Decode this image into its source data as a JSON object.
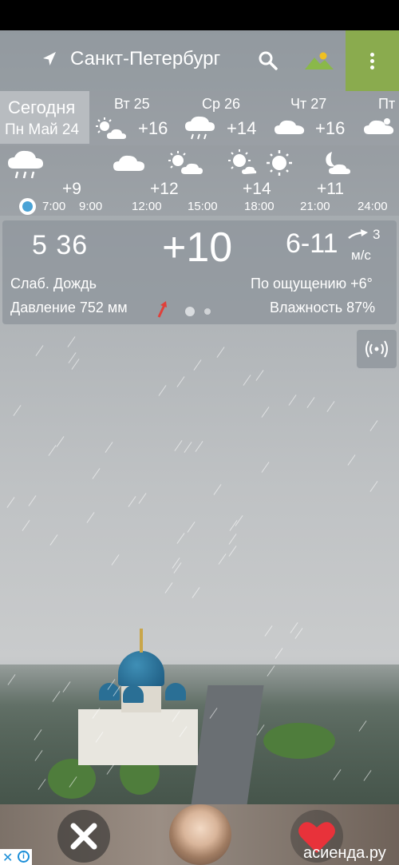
{
  "header": {
    "city": "Санкт-Петербург",
    "icons": [
      "location-arrow-icon",
      "search-icon",
      "landscape-photo-icon",
      "more-vert-icon"
    ],
    "accent_color": "#8aab4e"
  },
  "daily": {
    "today": {
      "label": "Сегодня",
      "date": "Пн Май 24"
    },
    "days": [
      {
        "name": "Вт 25",
        "temp": "+16",
        "icon": "sun-cloud-icon"
      },
      {
        "name": "Ср 26",
        "temp": "+14",
        "icon": "rain-cloud-icon"
      },
      {
        "name": "Чт 27",
        "temp": "+16",
        "icon": "cloud-icon"
      },
      {
        "name": "Пт",
        "temp": "",
        "icon": "cloud-icon"
      }
    ]
  },
  "hourly": {
    "temps": [
      "+9",
      "+12",
      "+14",
      "+11"
    ],
    "times": [
      "7:00",
      "9:00",
      "12:00",
      "15:00",
      "18:00",
      "21:00",
      "24:00"
    ],
    "icons": [
      "rain-cloud-icon",
      "cloud-icon",
      "sun-cloud-icon",
      "sun-small-cloud-icon",
      "sun-icon",
      "moon-cloud-icon"
    ]
  },
  "current": {
    "sunrise": "5 36",
    "temp": "+10",
    "wind_range": "6-11",
    "wind_speed": "3",
    "wind_unit": "м/с",
    "condition": "Слаб. Дождь",
    "feels_like": "По ощущению +6°",
    "pressure": "Давление 752 мм",
    "humidity": "Влажность 87%",
    "page_index": 1,
    "page_count": 2
  },
  "ad": {
    "site": "асиенда.ру"
  }
}
